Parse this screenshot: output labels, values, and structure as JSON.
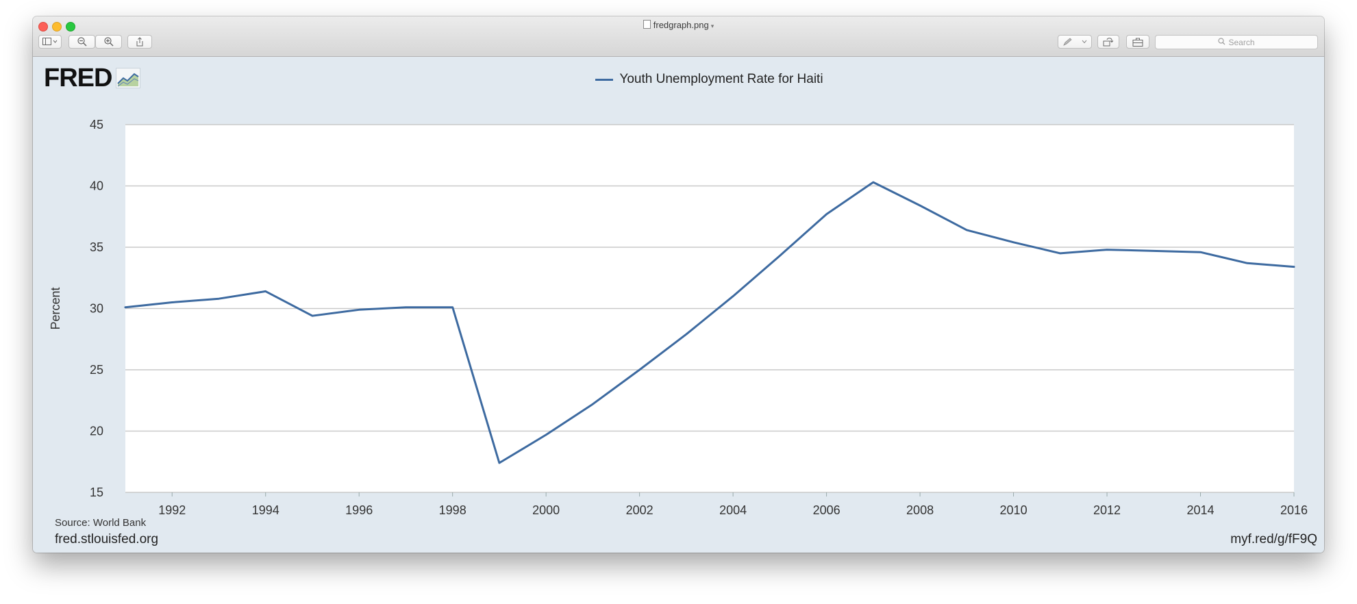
{
  "window": {
    "title": "fredgraph.png",
    "search_placeholder": "Search"
  },
  "toolbar": {
    "sidebar_icon": "sidebar-icon",
    "zoom_out_icon": "zoom-out-icon",
    "zoom_in_icon": "zoom-in-icon",
    "share_icon": "share-icon",
    "markup_icon": "markup-pen-icon",
    "rotate_icon": "rotate-icon",
    "toolbox_icon": "toolbox-icon"
  },
  "figure": {
    "logo": "FRED",
    "source": "Source: World Bank",
    "site": "fred.stlouisfed.org",
    "short_url": "myf.red/g/fF9Q"
  },
  "colors": {
    "line": "#3d6aa0",
    "background": "#e1e9f0",
    "plot_bg": "#ffffff",
    "grid": "#c9c9c9"
  },
  "chart_data": {
    "type": "line",
    "title": "",
    "xlabel": "",
    "ylabel": "Percent",
    "xlim": [
      1991,
      2016
    ],
    "ylim": [
      15,
      45
    ],
    "x_ticks": [
      1992,
      1994,
      1996,
      1998,
      2000,
      2002,
      2004,
      2006,
      2008,
      2010,
      2012,
      2014,
      2016
    ],
    "y_ticks": [
      15,
      20,
      25,
      30,
      35,
      40,
      45
    ],
    "grid": "horizontal",
    "legend_placement": "top-center",
    "series": [
      {
        "name": "Youth Unemployment Rate for Haiti",
        "x": [
          1991,
          1992,
          1993,
          1994,
          1995,
          1996,
          1997,
          1998,
          1999,
          2000,
          2001,
          2002,
          2003,
          2004,
          2005,
          2006,
          2007,
          2008,
          2009,
          2010,
          2011,
          2012,
          2013,
          2014,
          2015,
          2016
        ],
        "y": [
          30.1,
          30.5,
          30.8,
          31.4,
          29.4,
          29.9,
          30.1,
          30.1,
          17.4,
          19.7,
          22.2,
          25.0,
          27.9,
          31.0,
          34.3,
          37.7,
          40.3,
          38.4,
          36.4,
          35.4,
          34.5,
          34.8,
          34.7,
          34.6,
          33.7,
          33.4
        ]
      }
    ]
  }
}
